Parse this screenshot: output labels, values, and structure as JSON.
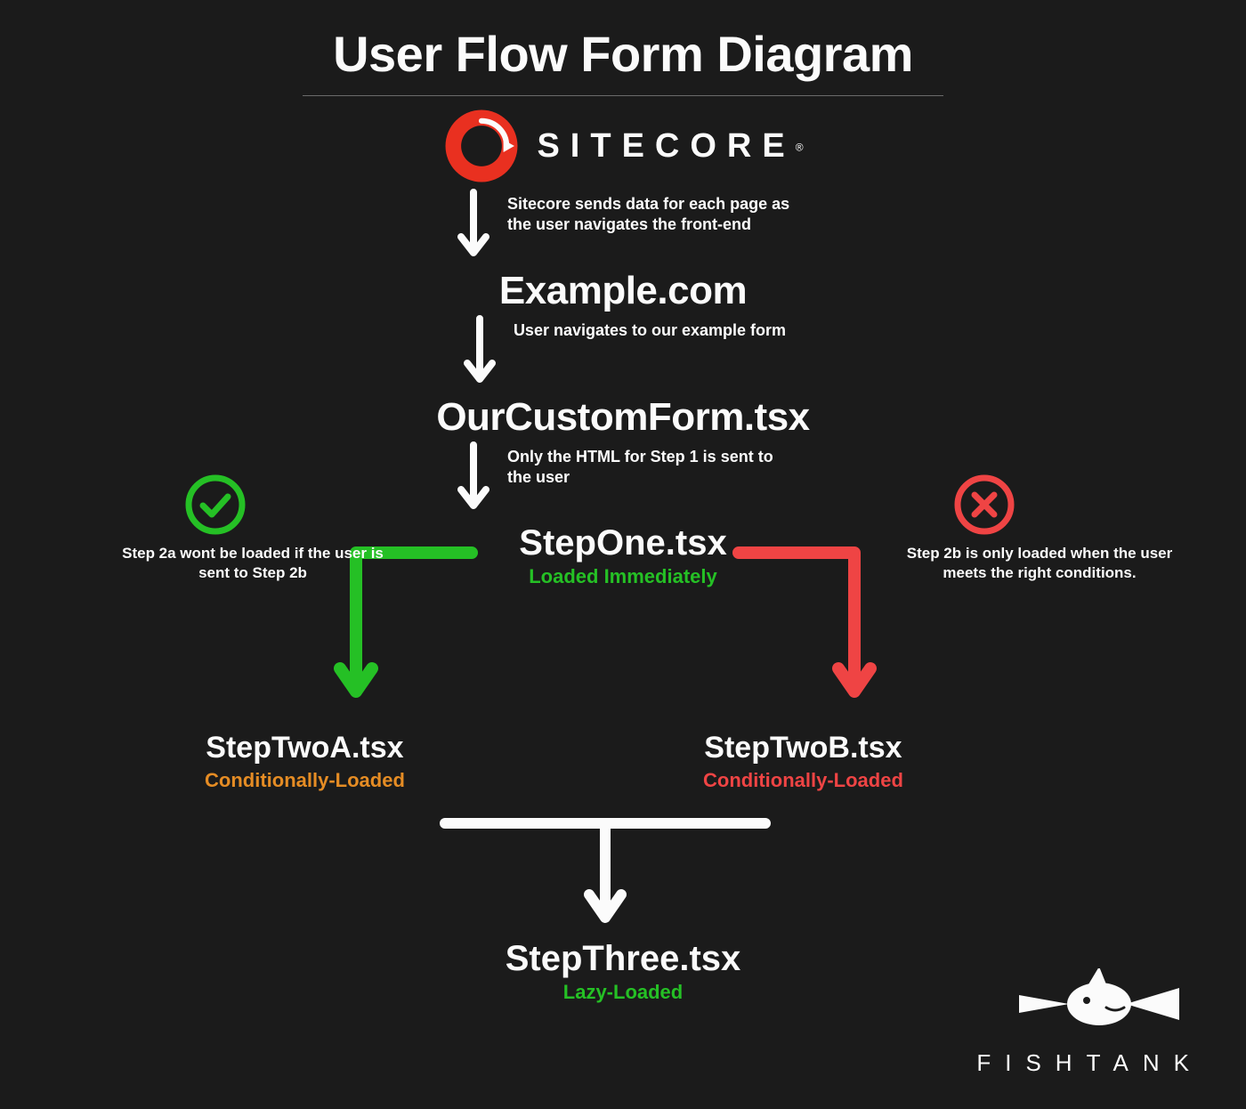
{
  "title": "User Flow Form Diagram",
  "brand": {
    "name": "SITECORE",
    "registered": "®"
  },
  "footer_brand": "FISHTANK",
  "nodes": {
    "n1": "Example.com",
    "n2": "OurCustomForm.tsx",
    "step1": {
      "name": "StepOne.tsx",
      "tag": "Loaded Immediately"
    },
    "step2a": {
      "name": "StepTwoA.tsx",
      "tag": "Conditionally-Loaded"
    },
    "step2b": {
      "name": "StepTwoB.tsx",
      "tag": "Conditionally-Loaded"
    },
    "step3": {
      "name": "StepThree.tsx",
      "tag": "Lazy-Loaded"
    }
  },
  "notes": {
    "a1": "Sitecore sends data for each page as the user navigates the front-end",
    "a2": "User navigates to our example form",
    "a3": "Only the HTML for Step 1 is sent to the user",
    "left": "Step 2a wont be loaded if the user is sent to Step 2b",
    "right": "Step 2b is only loaded when the user meets the right conditions."
  },
  "colors": {
    "green": "#25c025",
    "orange": "#e58c24",
    "red": "#ef4444",
    "accent_red": "#e93020",
    "white": "#fbfbfb",
    "bg": "#1b1b1b"
  }
}
